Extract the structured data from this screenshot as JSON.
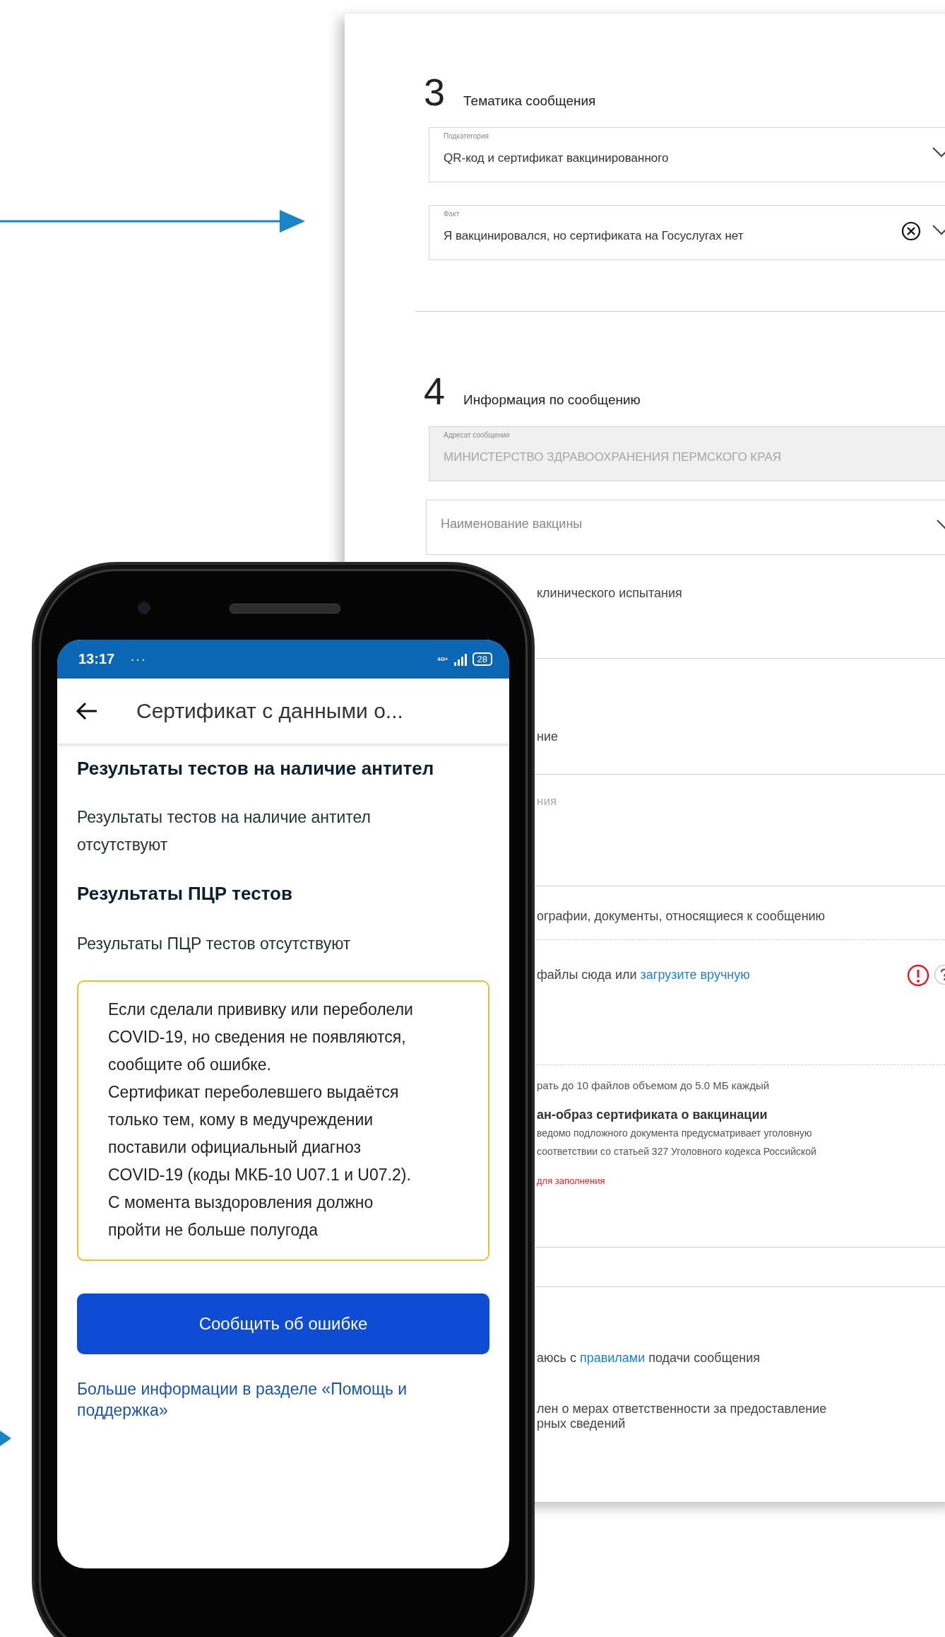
{
  "form": {
    "sections": [
      {
        "number": "3",
        "title": "Тематика сообщения",
        "fields": [
          {
            "label": "Подкатегория",
            "value": "QR-код и сертификат вакцинированного",
            "clearable": false,
            "disabled": false
          },
          {
            "label": "Факт",
            "value": "Я вакцинировался, но сертификата на Госуслугах нет",
            "clearable": true,
            "disabled": false
          }
        ]
      },
      {
        "number": "4",
        "title": "Информация по сообщению",
        "fields": [
          {
            "label": "Адресат сообщения",
            "value": "МИНИСТЕРСТВО ЗДРАВООХРАНЕНИЯ ПЕРМСКОГО КРАЯ",
            "clearable": false,
            "disabled": true
          }
        ]
      }
    ],
    "vaccine_select": {
      "placeholder": "Наименование вакцины"
    },
    "trial_text": "клинического испытания",
    "description_fragment": "ние",
    "description_label_fragment": "ния",
    "attachments_label": "ографии, документы, относящиеся к сообщению",
    "dropzone": {
      "text": "файлы сюда или ",
      "link": "загрузите вручную",
      "error": true
    },
    "files_limit": "рать до 10 файлов объемом до 5.0 МБ каждый",
    "scan_title": "ан-образ сертификата о вакцинации",
    "scan_warning": "ведомо подложного документа предусматривает уголовную\nсоответствии со статьей 327 Уголовного кодекса Российской",
    "required_text": "для заполнения",
    "rules_consent": {
      "before": "аюсь с ",
      "link": "правилами",
      "after": " подачи сообщения"
    },
    "responsibility_consent": "лен о мерах ответственности за предоставление\nрных сведений"
  },
  "phone": {
    "status_bar": {
      "time": "13:17",
      "notifications": "···",
      "network": "4G+",
      "battery": "28"
    },
    "app_bar": {
      "title": "Сертификат с данными о..."
    },
    "sections": [
      {
        "heading": "Результаты тестов на наличие антител",
        "text": "Результаты тестов на наличие антител\nотсутствуют"
      },
      {
        "heading": "Результаты ПЦР тестов",
        "text": "Результаты ПЦР тестов отсутствуют"
      }
    ],
    "notice": "Если сделали прививку или переболели\nCOVID-19, но сведения не появляются,\nсообщите об ошибке.\nСертификат переболевшего выдаётся\nтолько тем, кому в медучреждении\nпоставили официальный диагноз\nCOVID-19 (коды МКБ-10 U07.1 и U07.2).\nС момента выздоровления должно\nпройти не больше полугода",
    "button": "Сообщить об ошибке",
    "help_link": "Больше информации в разделе «Помощь и поддержка»"
  }
}
